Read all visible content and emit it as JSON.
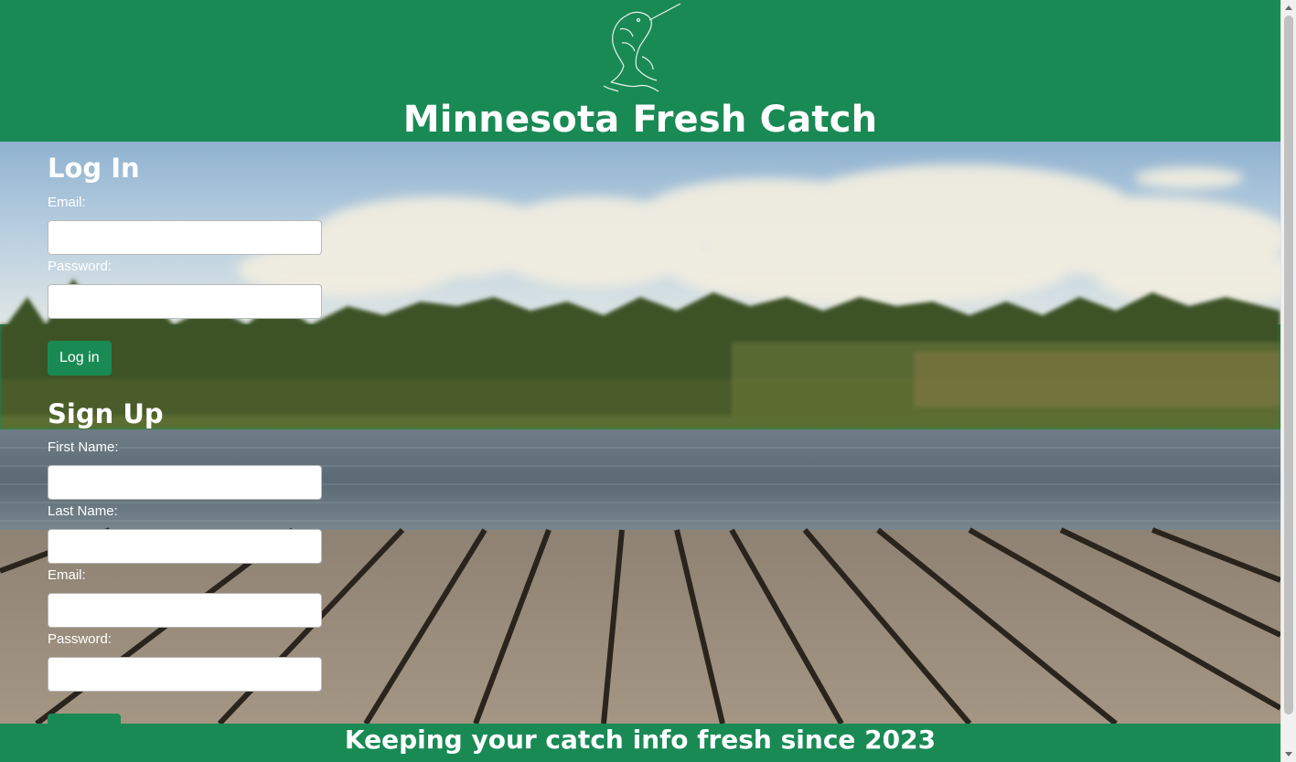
{
  "header": {
    "title": "Minnesota Fresh Catch",
    "logo_icon": "leaping-fish-icon"
  },
  "login": {
    "heading": "Log In",
    "email_label": "Email:",
    "email_value": "",
    "password_label": "Password:",
    "password_value": "",
    "submit_label": "Log in"
  },
  "signup": {
    "heading": "Sign Up",
    "first_name_label": "First Name:",
    "first_name_value": "",
    "last_name_label": "Last Name:",
    "last_name_value": "",
    "email_label": "Email:",
    "email_value": "",
    "password_label": "Password:",
    "password_value": ""
  },
  "footer": {
    "tagline": "Keeping your catch info fresh since 2023"
  },
  "colors": {
    "brand_green": "#1a8a55",
    "text_white": "#ffffff"
  }
}
